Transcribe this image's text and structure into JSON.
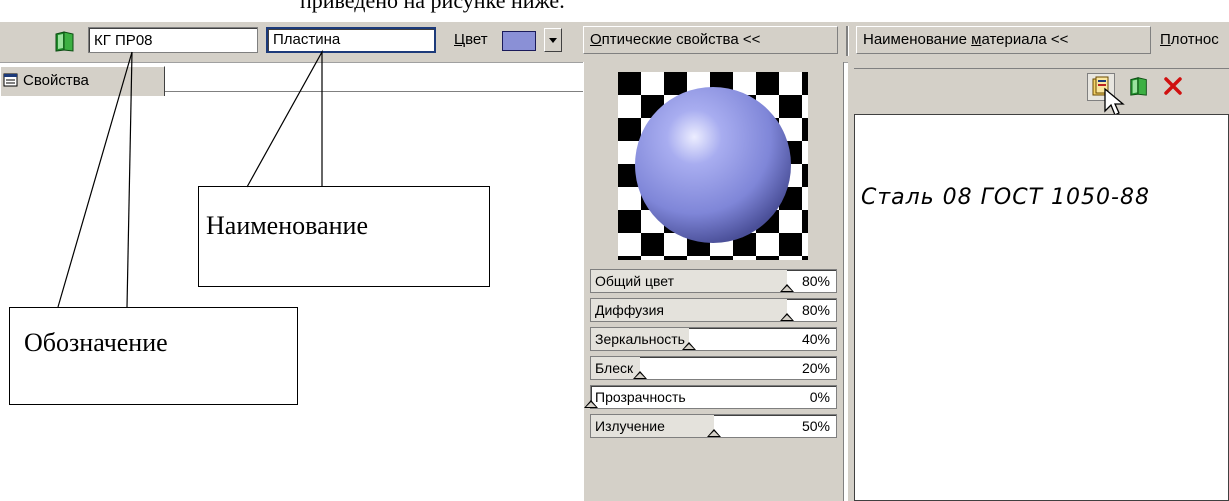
{
  "top_caption": "приведено на рисунке ниже.",
  "toolbar": {
    "designation_value": "КГ ПР08",
    "name_value": "Пластина",
    "color_label_first": "Ц",
    "color_label_rest": "вет",
    "optics_button_first": "О",
    "optics_button_rest": "птические свойства  <<",
    "material_button_prefix": "Наименование ",
    "material_button_u": "м",
    "material_button_rest": "атериала  <<",
    "density_prefix": "",
    "density_u": "П",
    "density_rest": "лотнос",
    "accent_color": "#8a90d6"
  },
  "tab": {
    "label": "Свойства",
    "icon": "properties-icon"
  },
  "optics": {
    "sliders": [
      {
        "label": "Общий цвет",
        "value": "80%",
        "level": 80
      },
      {
        "label": "Диффузия",
        "value": "80%",
        "level": 80
      },
      {
        "label": "Зеркальность",
        "value": "40%",
        "level": 40
      },
      {
        "label": "Блеск",
        "value": "20%",
        "level": 20
      },
      {
        "label": "Прозрачность",
        "value": "0%",
        "level": 0
      },
      {
        "label": "Излучение",
        "value": "50%",
        "level": 50
      }
    ]
  },
  "material": {
    "text": "Сталь 08  ГОСТ 1050-88",
    "icons": [
      "library-icon",
      "book-icon",
      "delete-icon"
    ]
  },
  "callouts": {
    "name": "Наименование",
    "designation": "Обозначение"
  }
}
